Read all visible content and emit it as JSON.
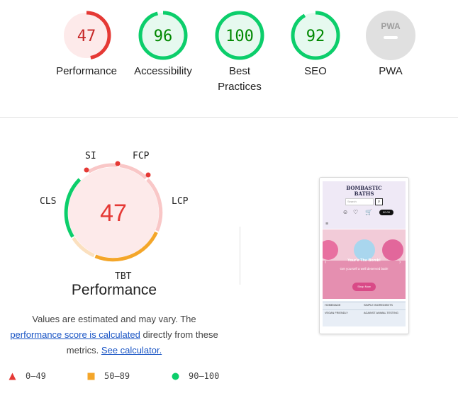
{
  "categories": [
    {
      "label": "Performance",
      "score": "47",
      "status": "fail",
      "fraction": 0.47
    },
    {
      "label": "Accessibility",
      "score": "96",
      "status": "pass",
      "fraction": 0.96
    },
    {
      "label": "Best Practices",
      "score": "100",
      "status": "pass",
      "fraction": 1.0
    },
    {
      "label": "SEO",
      "score": "92",
      "status": "pass",
      "fraction": 0.92
    },
    {
      "label": "PWA",
      "score": "",
      "status": "na",
      "fraction": 0
    }
  ],
  "pwa_badge_text": "PWA",
  "performance": {
    "score": "47",
    "title": "Performance",
    "metrics": {
      "si": "SI",
      "fcp": "FCP",
      "lcp": "LCP",
      "tbt": "TBT",
      "cls": "CLS"
    },
    "description_pre": "Values are estimated and may vary. The",
    "score_link": "performance score is calculated",
    "description_mid": "directly from these metrics.",
    "calculator_link": "See calculator."
  },
  "legend": [
    {
      "shape": "triangle",
      "range": "0–49",
      "color": "#e53935"
    },
    {
      "shape": "square",
      "range": "50–89",
      "color": "#f4a62a"
    },
    {
      "shape": "circle",
      "range": "90–100",
      "color": "#0cce6b"
    }
  ],
  "colors": {
    "fail": "#e53935",
    "fail_bg": "#fdeaea",
    "average": "#f4a62a",
    "pass": "#0cce6b",
    "pass_text": "#008800",
    "pass_bg": "#e6f9ef",
    "na": "#cccccc",
    "link": "#1a55c5"
  },
  "screenshot": {
    "logo_line1": "BOMBASTIC",
    "logo_line2": "BATHS",
    "search_placeholder": "Search",
    "cart_total": "£0.00",
    "hero_title": "Your'e The Bomb!",
    "hero_subtitle": "Get yourself a well deserved bath!",
    "hero_button": "Shop Now",
    "features": [
      "HOMEMADE",
      "SIMPLE INGREDIENTS",
      "VEGAN FRIENDLY",
      "AGAINST ANIMAL TESTING"
    ]
  }
}
